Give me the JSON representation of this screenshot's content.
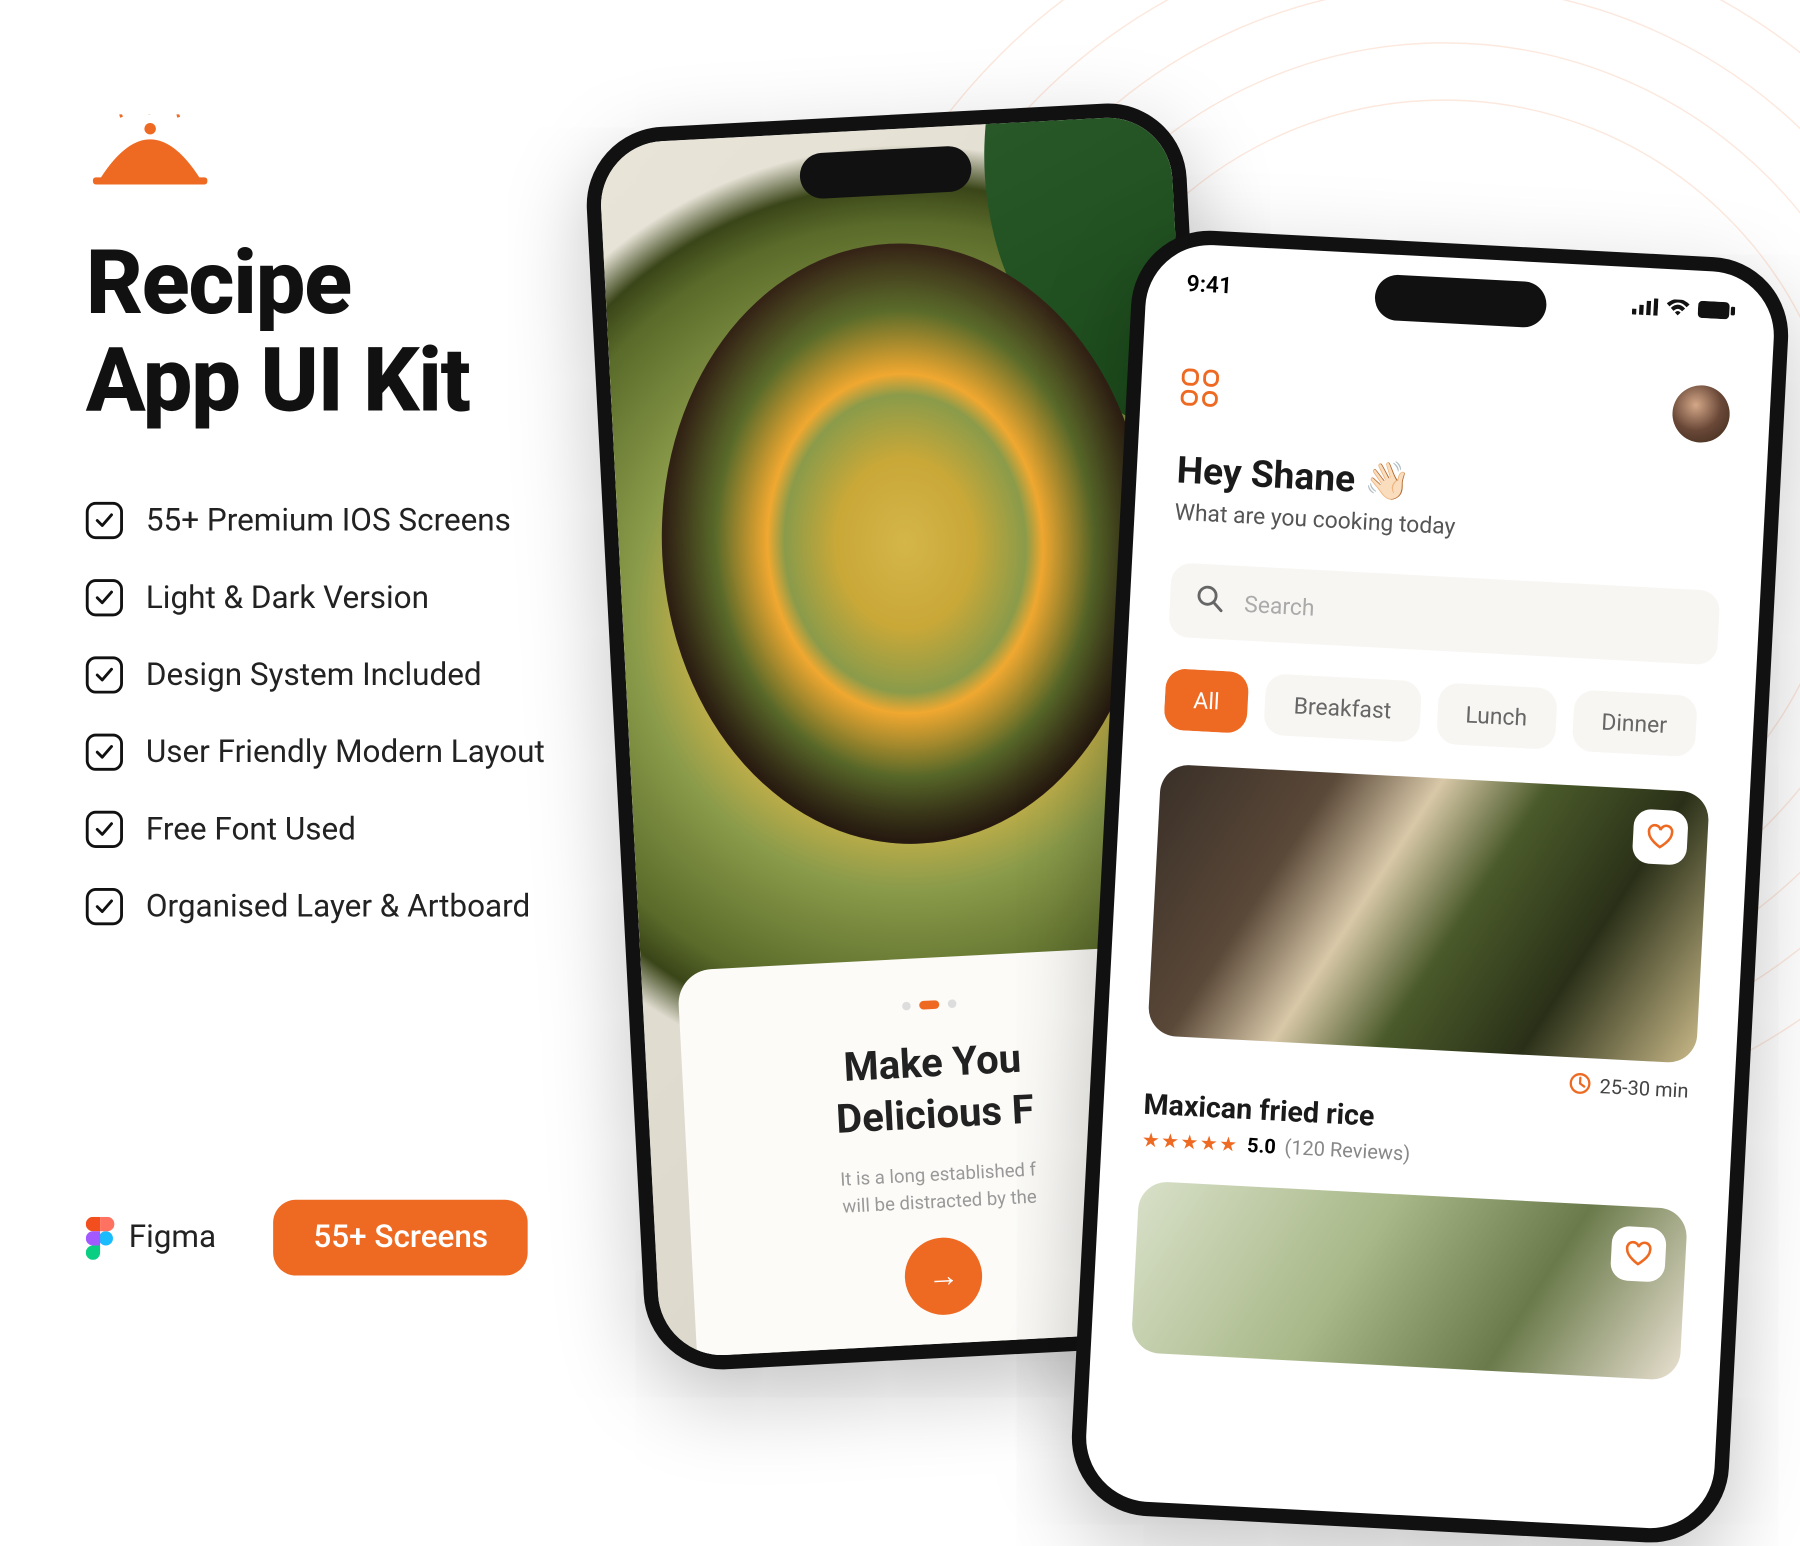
{
  "colors": {
    "accent": "#ee6a23"
  },
  "title_line1": "Recipe",
  "title_line2": "App UI Kit",
  "features": [
    "55+ Premium IOS Screens",
    "Light & Dark Version",
    "Design System Included",
    "User Friendly Modern Layout",
    "Free Font Used",
    "Organised Layer & Artboard"
  ],
  "figma_label": "Figma",
  "screens_badge": "55+ Screens",
  "phone1": {
    "heading_line1": "Make You",
    "heading_line2": "Delicious F",
    "subtitle_line1": "It is a long established f",
    "subtitle_line2": "will be distracted by the"
  },
  "phone2": {
    "time": "9:41",
    "greeting": "Hey Shane 👋🏻",
    "subtitle": "What are you cooking today",
    "search_placeholder": "Search",
    "chips": [
      "All",
      "Breakfast",
      "Lunch",
      "Dinner"
    ],
    "card": {
      "title": "Maxican fried rice",
      "rating": "5.0",
      "reviews": "(120 Reviews)",
      "time": "25-30 min"
    }
  }
}
